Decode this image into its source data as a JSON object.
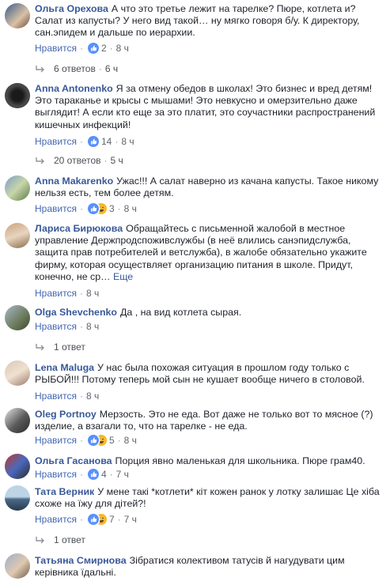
{
  "ui": {
    "like_label": "Нравится",
    "more_label": "Еще"
  },
  "comments": [
    {
      "author": "Ольга Орехова",
      "text": "А что это третье лежит на тарелке? Пюре, котлета и? Салат из капусты? У него вид такой… ну мягко говоря б/у. К директору, сан.эпидем и дальше по иерархии.",
      "reaction_count": "2",
      "time": "8 ч",
      "replies": "6 ответов",
      "replies_time": "6 ч"
    },
    {
      "author": "Anna Antonenko",
      "text": "Я за отмену обедов в школах! Это бизнес и вред детям! Это тараканье и крысы с мышами! Это невкусно и омерзительно даже выглядит! А если кто еще за это платит, это соучастники распространений кишечных инфекций!",
      "reaction_count": "14",
      "time": "8 ч",
      "replies": "20 ответов",
      "replies_time": "5 ч"
    },
    {
      "author": "Anna Makarenko",
      "text": "Ужас!!! А салат наверно из качана капусты. Такое никому нельзя есть, тем более детям.",
      "reaction_count": "3",
      "time": "8 ч"
    },
    {
      "author": "Лариса Бирюкова",
      "text": "Обращайтесь с письменной жалобой в местное управление Держпродспоживслужбы (в неё влились санэпидслужба, защита прав потребителей и ветслужба), в жалобе обязательно укажите фирму, которая осуществляет организацию питания в школе. Придут, конечно, не ср…",
      "reaction_count": "",
      "time": "8 ч"
    },
    {
      "author": "Olga Shevchenko",
      "text": "Да , на вид котлета сырая.",
      "reaction_count": "",
      "time": "8 ч",
      "replies": "1 ответ"
    },
    {
      "author": "Lena Maluga",
      "text": "У нас была похожая ситуация в прошлом году только с РЫБОЙ!!! Потому теперь мой сын не кушает вообще ничего в столовой.",
      "reaction_count": "",
      "time": "8 ч"
    },
    {
      "author": "Oleg Portnoy",
      "text": "Мерзость. Это не еда. Вот даже не только вот то мясное (?) изделие, а взагали то, что на тарелке - не еда.",
      "reaction_count": "5",
      "time": "8 ч"
    },
    {
      "author": "Ольга Гасанова",
      "text": "Порция явно маленькая для школьника. Пюре грам40.",
      "reaction_count": "4",
      "time": "7 ч"
    },
    {
      "author": "Тата Верник",
      "text": "У мене такі *котлети* кіт кожен ранок у лотку залишає Це хіба схоже на їжу для дітей?!",
      "reaction_count": "7",
      "time": "7 ч",
      "replies": "1 ответ"
    },
    {
      "author": "Татьяна Смирнова",
      "text": "Зібратися колективом татусів й нагудувати цим керівника їдальні.",
      "reaction_count": "",
      "time": ""
    }
  ],
  "colors": {
    "link": "#385898",
    "like_blue": "#4267b2",
    "meta": "#616770",
    "haha": "#f7b928"
  }
}
